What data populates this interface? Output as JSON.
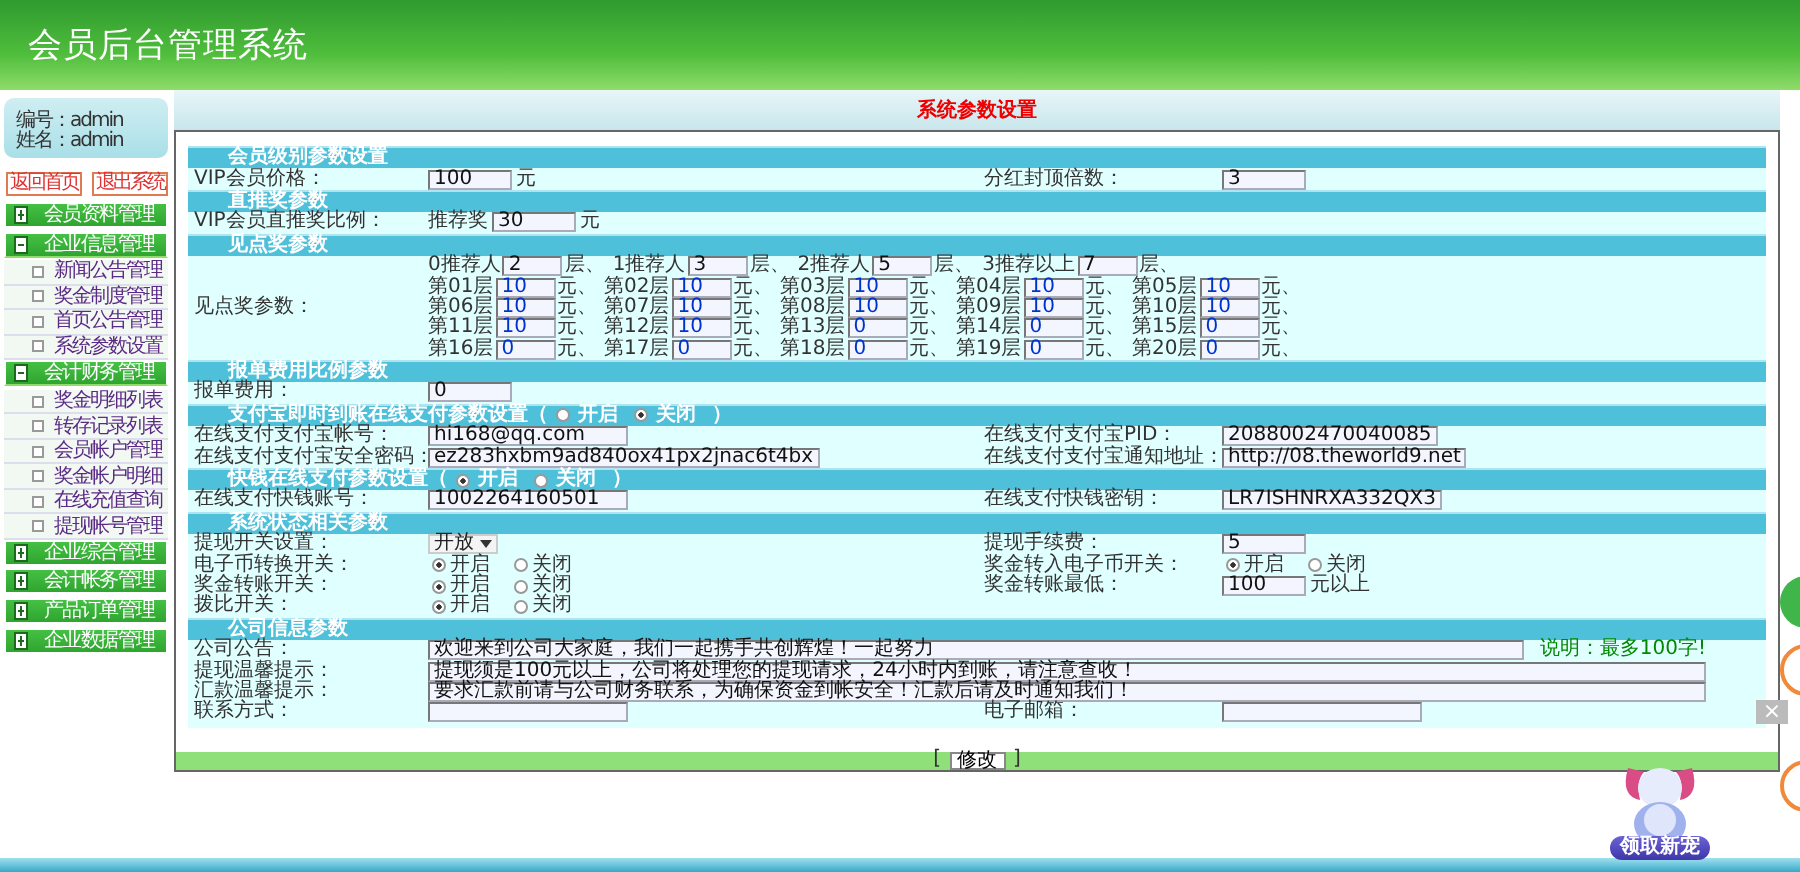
{
  "header": {
    "title": "会员后台管理系统"
  },
  "user": {
    "lines": [
      "编号：admin",
      "姓名：admin"
    ]
  },
  "sidebar_buttons": [
    "返回首页",
    "退出系统"
  ],
  "menu": [
    {
      "label": "会员资料管理",
      "expanded": false
    },
    {
      "label": "企业信息管理",
      "expanded": true,
      "children": [
        {
          "label": "新闻公告管理"
        },
        {
          "label": "奖金制度管理"
        },
        {
          "label": "首页公告管理"
        },
        {
          "label": "系统参数设置"
        }
      ]
    },
    {
      "label": "会计财务管理",
      "expanded": true,
      "children": [
        {
          "label": "奖金明细列表"
        },
        {
          "label": "转存记录列表"
        },
        {
          "label": "会员帐户管理"
        },
        {
          "label": "奖金帐户明细"
        },
        {
          "label": "在线充值查询"
        },
        {
          "label": "提现帐号管理"
        }
      ]
    },
    {
      "label": "企业综合管理",
      "expanded": false
    },
    {
      "label": "会计帐务管理",
      "expanded": false
    },
    {
      "label": "产品订单管理",
      "expanded": false
    },
    {
      "label": "企业数据管理",
      "expanded": false
    }
  ],
  "page_title": "系统参数设置",
  "sections": [
    {
      "title": "会员级别参数设置",
      "rows": [
        {
          "kind": "pair",
          "cells": [
            {
              "label": "VIP会员价格：",
              "field": {
                "kind": "short_input",
                "value": "100",
                "suffix": "元"
              }
            },
            {
              "label": "分红封顶倍数：",
              "field": {
                "kind": "short_input",
                "value": "3"
              }
            }
          ]
        }
      ]
    },
    {
      "title": "直推奖参数",
      "rows": [
        {
          "kind": "pair",
          "cells": [
            {
              "label": "VIP会员直推奖比例：",
              "field": {
                "kind": "short_input",
                "prefix": "推荐奖",
                "value": "30",
                "suffix": "元"
              }
            }
          ]
        }
      ]
    },
    {
      "title": "见点奖参数",
      "rows": [
        {
          "kind": "full",
          "cells": [
            {
              "label": "见点奖参数：",
              "field": {
                "kind": "grid",
                "tiers": [
                  {
                    "label": "0推荐人",
                    "value": "2",
                    "unit": "层、"
                  },
                  {
                    "label": "1推荐人",
                    "value": "3",
                    "unit": "层、"
                  },
                  {
                    "label": "2推荐人",
                    "value": "5",
                    "unit": "层、"
                  },
                  {
                    "label": "3推荐以上",
                    "value": "7",
                    "unit": "层、"
                  }
                ],
                "levels": [
                  {
                    "label": "第01层",
                    "value": "10",
                    "unit": "元、"
                  },
                  {
                    "label": "第02层",
                    "value": "10",
                    "unit": "元、"
                  },
                  {
                    "label": "第03层",
                    "value": "10",
                    "unit": "元、"
                  },
                  {
                    "label": "第04层",
                    "value": "10",
                    "unit": "元、"
                  },
                  {
                    "label": "第05层",
                    "value": "10",
                    "unit": "元、"
                  },
                  {
                    "label": "第06层",
                    "value": "10",
                    "unit": "元、"
                  },
                  {
                    "label": "第07层",
                    "value": "10",
                    "unit": "元、"
                  },
                  {
                    "label": "第08层",
                    "value": "10",
                    "unit": "元、"
                  },
                  {
                    "label": "第09层",
                    "value": "10",
                    "unit": "元、"
                  },
                  {
                    "label": "第10层",
                    "value": "10",
                    "unit": "元、"
                  },
                  {
                    "label": "第11层",
                    "value": "10",
                    "unit": "元、"
                  },
                  {
                    "label": "第12层",
                    "value": "10",
                    "unit": "元、"
                  },
                  {
                    "label": "第13层",
                    "value": "0",
                    "unit": "元、"
                  },
                  {
                    "label": "第14层",
                    "value": "0",
                    "unit": "元、"
                  },
                  {
                    "label": "第15层",
                    "value": "0",
                    "unit": "元、"
                  },
                  {
                    "label": "第16层",
                    "value": "0",
                    "unit": "元、"
                  },
                  {
                    "label": "第17层",
                    "value": "0",
                    "unit": "元、"
                  },
                  {
                    "label": "第18层",
                    "value": "0",
                    "unit": "元、"
                  },
                  {
                    "label": "第19层",
                    "value": "0",
                    "unit": "元、"
                  },
                  {
                    "label": "第20层",
                    "value": "0",
                    "unit": "元、"
                  }
                ]
              }
            }
          ]
        }
      ]
    },
    {
      "title": "报单费用比例参数",
      "rows": [
        {
          "kind": "pair",
          "cells": [
            {
              "label": "报单费用：",
              "field": {
                "kind": "short_input",
                "value": "0"
              }
            }
          ]
        }
      ]
    },
    {
      "title": "支付宝即时到账在线支付参数设置（",
      "options": [
        {
          "label": "开启",
          "selected": false
        },
        {
          "label": "关闭",
          "selected": true
        }
      ],
      "title_end": "）",
      "rows": [
        {
          "kind": "pair",
          "cells": [
            {
              "label": "在线支付支付宝帐号：",
              "field": {
                "kind": "input",
                "value": "hi168@qq.com"
              }
            },
            {
              "label": "在线支付支付宝PID：",
              "field": {
                "kind": "input",
                "value": "2088002470040085"
              }
            }
          ]
        },
        {
          "kind": "pair",
          "cells": [
            {
              "label": "在线支付支付宝安全密码：",
              "field": {
                "kind": "input",
                "value": "ez283hxbm9ad840ox41px2jnac6t4bx"
              }
            },
            {
              "label": "在线支付支付宝通知地址：",
              "field": {
                "kind": "input",
                "value": "http://08.theworld9.net"
              }
            }
          ]
        }
      ]
    },
    {
      "title": "快钱在线支付参数设置（",
      "options": [
        {
          "label": "开启",
          "selected": true
        },
        {
          "label": "关闭",
          "selected": false
        }
      ],
      "title_end": "）",
      "rows": [
        {
          "kind": "pair",
          "cells": [
            {
              "label": "在线支付快钱账号：",
              "field": {
                "kind": "input",
                "value": "1002264160501"
              }
            },
            {
              "label": "在线支付快钱密钥：",
              "field": {
                "kind": "input",
                "value": "LR7ISHNRXA332QX3"
              }
            }
          ]
        }
      ]
    },
    {
      "title": "系统状态相关参数",
      "rows": [
        {
          "kind": "pair",
          "cells": [
            {
              "label": "提现开关设置：",
              "field": {
                "kind": "select",
                "value": "开放"
              }
            },
            {
              "label": "提现手续费：",
              "field": {
                "kind": "short_input",
                "value": "5"
              }
            }
          ]
        },
        {
          "kind": "pair",
          "cells": [
            {
              "label": "电子币转换开关：",
              "field": {
                "kind": "radio",
                "options": [
                  {
                    "label": "开启",
                    "selected": true
                  },
                  {
                    "label": "关闭",
                    "selected": false
                  }
                ]
              }
            },
            {
              "label": "奖金转入电子币开关：",
              "field": {
                "kind": "radio",
                "options": [
                  {
                    "label": "开启",
                    "selected": true
                  },
                  {
                    "label": "关闭",
                    "selected": false
                  }
                ]
              }
            }
          ]
        },
        {
          "kind": "pair",
          "cells": [
            {
              "label": "奖金转账开关：",
              "field": {
                "kind": "radio",
                "options": [
                  {
                    "label": "开启",
                    "selected": true
                  },
                  {
                    "label": "关闭",
                    "selected": false
                  }
                ]
              }
            },
            {
              "label": "奖金转账最低：",
              "field": {
                "kind": "short_input",
                "value": "100",
                "suffix": "元以上"
              }
            }
          ]
        },
        {
          "kind": "pair",
          "cells": [
            {
              "label": "拨比开关：",
              "field": {
                "kind": "radio",
                "options": [
                  {
                    "label": "开启",
                    "selected": true
                  },
                  {
                    "label": "关闭",
                    "selected": false
                  }
                ]
              }
            }
          ]
        }
      ]
    },
    {
      "title": "公司信息参数",
      "rows": [
        {
          "kind": "full",
          "cells": [
            {
              "label": "公司公告：",
              "field": {
                "kind": "long_input",
                "value": "欢迎来到公司大家庭，我们一起携手共创辉煌！一起努力",
                "note": "说明：最多100字!"
              }
            }
          ]
        },
        {
          "kind": "full",
          "cells": [
            {
              "label": "提现温馨提示：",
              "field": {
                "kind": "long_input",
                "value": "提现须是100元以上，公司将处理您的提现请求，24小时内到账，请注意查收！"
              }
            }
          ]
        },
        {
          "kind": "full",
          "cells": [
            {
              "label": "汇款温馨提示：",
              "field": {
                "kind": "long_input",
                "value": "要求汇款前请与公司财务联系，为确保资金到帐安全！汇款后请及时通知我们！"
              }
            }
          ]
        },
        {
          "kind": "pair",
          "cells": [
            {
              "label": "联系方式：",
              "field": {
                "kind": "input"
              }
            },
            {
              "label": "电子邮箱：",
              "field": {
                "kind": "input"
              }
            }
          ]
        }
      ]
    }
  ],
  "submit": {
    "open": "[",
    "label": "修改",
    "close": "]"
  },
  "overlay": {
    "close": "×",
    "badge": "领取新宠"
  }
}
